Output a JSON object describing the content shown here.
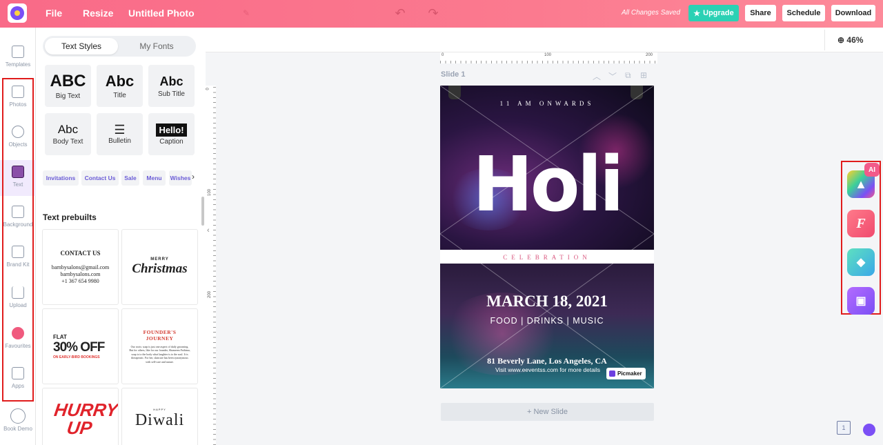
{
  "topbar": {
    "file": "File",
    "resize": "Resize",
    "doc_title": "Untitled Photo",
    "status": "All Changes Saved",
    "upgrade": "Upgrade",
    "share": "Share",
    "schedule": "Schedule",
    "download": "Download"
  },
  "sidebar": {
    "items": [
      {
        "label": "Templates"
      },
      {
        "label": "Photos"
      },
      {
        "label": "Objects"
      },
      {
        "label": "Text"
      },
      {
        "label": "Background"
      },
      {
        "label": "Brand Kit"
      },
      {
        "label": "Upload"
      },
      {
        "label": "Favourites"
      },
      {
        "label": "Apps"
      },
      {
        "label": "Book Demo"
      }
    ]
  },
  "panel": {
    "tabs": [
      "Text Styles",
      "My Fonts"
    ],
    "styles": [
      {
        "sample": "ABC",
        "label": "Big Text"
      },
      {
        "sample": "Abc",
        "label": "Title"
      },
      {
        "sample": "Abc",
        "label": "Sub Title"
      },
      {
        "sample": "Abc",
        "label": "Body Text"
      },
      {
        "sample": "",
        "label": "Bulletin"
      },
      {
        "sample": "Hello!",
        "label": "Caption"
      }
    ],
    "chips": [
      "Invitations",
      "Contact Us",
      "Sale",
      "Menu",
      "Wishes"
    ],
    "heading": "Text prebuilts",
    "prebuilts": {
      "contact": {
        "title": "CONTACT US",
        "lines": [
          "barnbysalons@gmail.com",
          "barnbysalons.com",
          "+1 367 654 9980"
        ]
      },
      "christmas": {
        "top": "MERRY",
        "main": "Christmas"
      },
      "sale": {
        "top": "FLAT",
        "main": "30% OFF",
        "sub": "ON EARLY-BIRD BOOKINGS"
      },
      "journey": {
        "title": "FOUNDER'S JOURNEY",
        "body": "Our roots: soap is just one aspect of daily grooming. But for others, like for our founder, Shameem Fathima, soap is to the body what laughter is to the soul. It is therapeutic. For her, skincare has been synonymous with self-care and nature."
      },
      "hurry": {
        "main": "HURRY UP"
      },
      "diwali": {
        "top": "HAPPY",
        "main": "Diwali"
      }
    }
  },
  "canvas": {
    "zoom": "46%",
    "ruler_top": [
      "0",
      "100",
      "200"
    ],
    "ruler_left": [
      "0",
      "100",
      "200"
    ],
    "slide_label": "Slide 1",
    "new_slide": "+ New Slide",
    "page_number": "1"
  },
  "poster": {
    "tagline": "11 AM ONWARDS",
    "headline": "Holi",
    "subtitle": "CELEBRATION",
    "date": "MARCH 18, 2021",
    "details": "FOOD | DRINKS | MUSIC",
    "address": "81 Beverly Lane, Los Angeles, CA",
    "visit": "Visit www.eeventss.com for more details",
    "badge": "Picmaker"
  },
  "right_tools": {
    "ai_badge": "AI"
  },
  "colors": {
    "topbar": "#f96a88",
    "accent_teal": "#2bd1b4",
    "accent_purple": "#7b4ff5",
    "highlight_red": "#e01b1b"
  }
}
